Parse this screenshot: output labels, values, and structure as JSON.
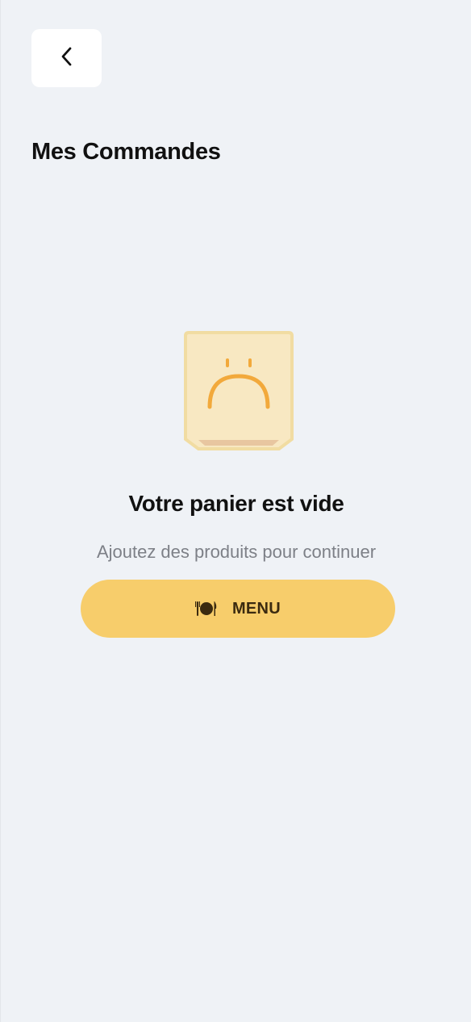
{
  "header": {
    "back_icon": "chevron-left-icon",
    "title": "Mes Commandes"
  },
  "empty_state": {
    "illustration": "sad-bag-icon",
    "title": "Votre panier est vide",
    "subtitle": "Ajoutez des produits pour continuer",
    "button": {
      "icon": "plate-cutlery-icon",
      "label": "MENU"
    }
  },
  "colors": {
    "background": "#eff2f6",
    "accent": "#f7cd6b",
    "illustration_face": "#f2a93b"
  }
}
